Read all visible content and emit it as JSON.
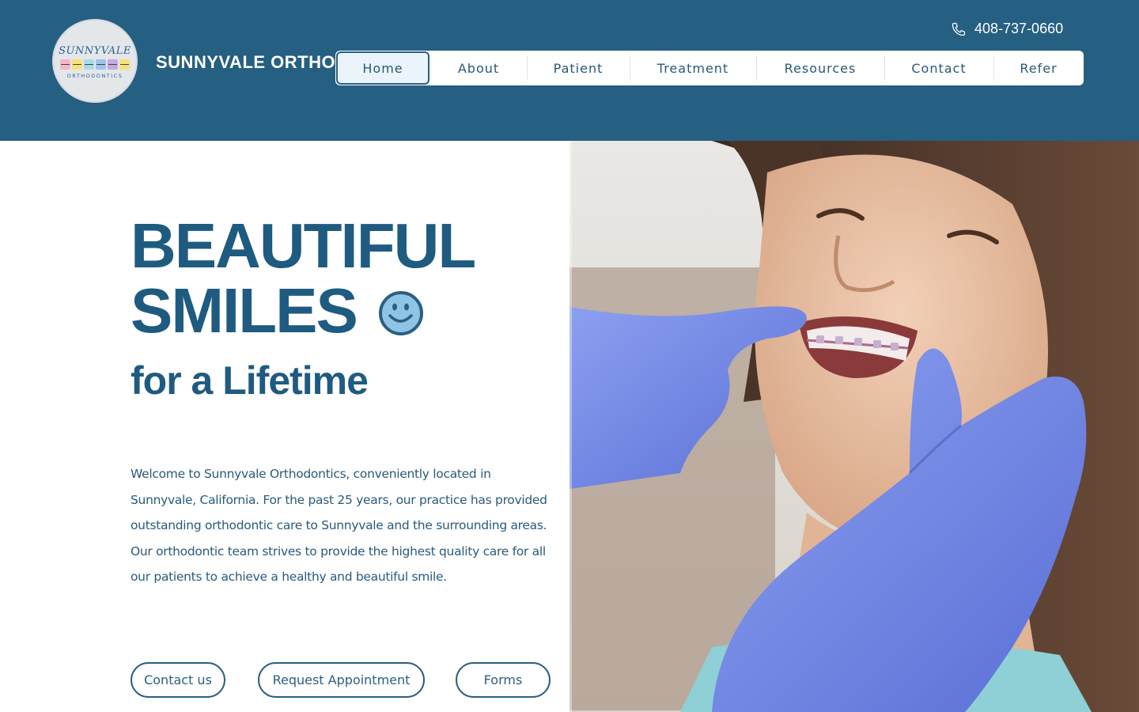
{
  "header": {
    "brand_name": "SUNNYVALE ORTHO",
    "logo_text": {
      "script": "SUNNYVALE",
      "sub": "ORTHODONTICS"
    },
    "phone": "408-737-0660",
    "bg_color": "#255f82"
  },
  "nav": {
    "items": [
      {
        "label": "Home",
        "active": true
      },
      {
        "label": "About",
        "active": false
      },
      {
        "label": "Patient",
        "active": false
      },
      {
        "label": "Treatment",
        "active": false
      },
      {
        "label": "Resources",
        "active": false
      },
      {
        "label": "Contact",
        "active": false
      },
      {
        "label": "Refer",
        "active": false
      }
    ]
  },
  "hero": {
    "title_line1": "BEAUTIFUL",
    "title_line2": "SMILES",
    "subtitle": "for a Lifetime",
    "body": "Welcome to Sunnyvale Orthodontics, conveniently located in Sunnyvale, California. For the past 25 years, our practice has provided outstanding orthodontic care to Sunnyvale and the surrounding areas. Our orthodontic team strives to provide the highest quality care for all our patients to achieve a healthy and beautiful smile.",
    "buttons": {
      "contact": "Contact us",
      "appointment": "Request Appointment",
      "forms": "Forms"
    },
    "accent_color": "#1f5b80"
  },
  "icons": {
    "phone": "phone-icon",
    "smiley": "smiley-icon"
  }
}
